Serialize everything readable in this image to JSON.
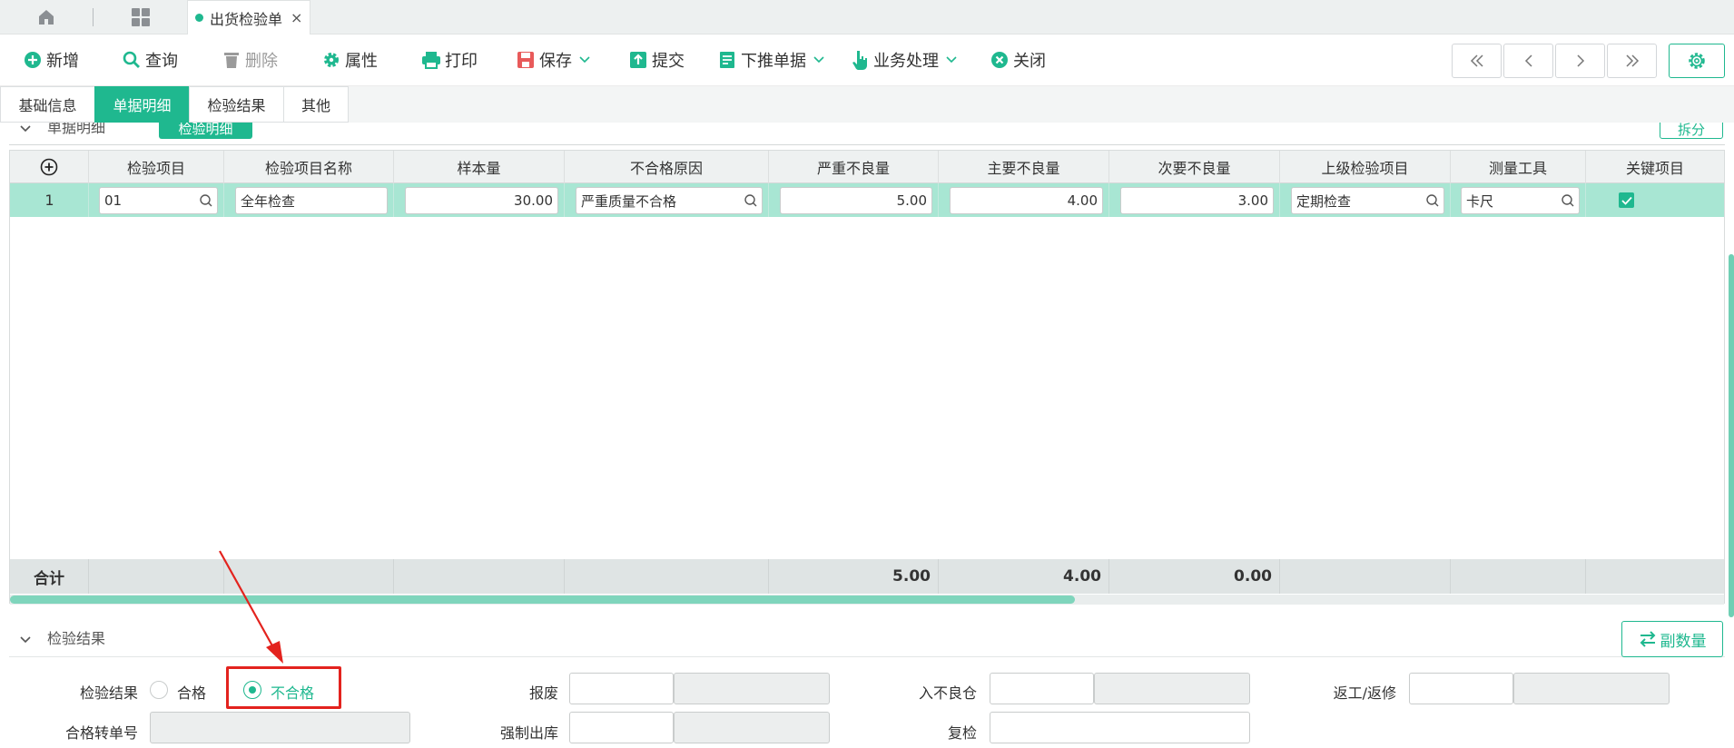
{
  "tabbar": {
    "home_icon": "home-icon",
    "apps_icon": "grid-apps-icon",
    "doc_tab_label": "出货检验单",
    "close_glyph": "×"
  },
  "toolbar": {
    "buttons": [
      {
        "label": "新增",
        "icon": "plus-circle-icon"
      },
      {
        "label": "查询",
        "icon": "search-icon"
      },
      {
        "label": "删除",
        "icon": "trash-icon"
      },
      {
        "label": "属性",
        "icon": "gear-icon"
      },
      {
        "label": "打印",
        "icon": "printer-icon"
      },
      {
        "label": "保存",
        "icon": "save-icon"
      },
      {
        "label": "提交",
        "icon": "upload-icon"
      },
      {
        "label": "下推单据",
        "icon": "document-push-icon"
      },
      {
        "label": "业务处理",
        "icon": "hand-pointer-icon"
      },
      {
        "label": "关闭",
        "icon": "close-circle-icon"
      }
    ],
    "nav": [
      "first-icon",
      "prev-icon",
      "next-icon",
      "last-icon"
    ],
    "accent": "#1fb88f",
    "danger": "#e85a5a"
  },
  "subtabs": [
    "基础信息",
    "单据明细",
    "检验结果",
    "其他"
  ],
  "section1": {
    "title": "单据明细",
    "tab_label": "检验明细",
    "split_label": "拆分"
  },
  "grid": {
    "add_icon": "add-row-icon",
    "columns": [
      "检验项目",
      "检验项目名称",
      "样本量",
      "不合格原因",
      "严重不良量",
      "主要不良量",
      "次要不良量",
      "上级检验项目",
      "测量工具",
      "关键项目"
    ],
    "row": {
      "no": "1",
      "item": "01",
      "item_name": "全年检查",
      "sample": "30.00",
      "reason": "严重质量不合格",
      "severe": "5.00",
      "major": "4.00",
      "minor": "3.00",
      "parent_item": "定期检查",
      "tool": "卡尺",
      "key_item": true
    },
    "total_label": "合计",
    "totals": {
      "severe": "5.00",
      "major": "4.00",
      "minor": "0.00"
    }
  },
  "section2": {
    "title": "检验结果",
    "qty_button": "副数量"
  },
  "form": {
    "result_label": "检验结果",
    "pass_label": "合格",
    "fail_label": "不合格",
    "selected": "不合格",
    "scrap_label": "报废",
    "bad_wh_label": "入不良仓",
    "rework_label": "返工/返修",
    "pass_transfer_label": "合格转单号",
    "force_out_label": "强制出库",
    "recheck_label": "复检"
  },
  "annotation": {
    "color": "#e3231e"
  }
}
